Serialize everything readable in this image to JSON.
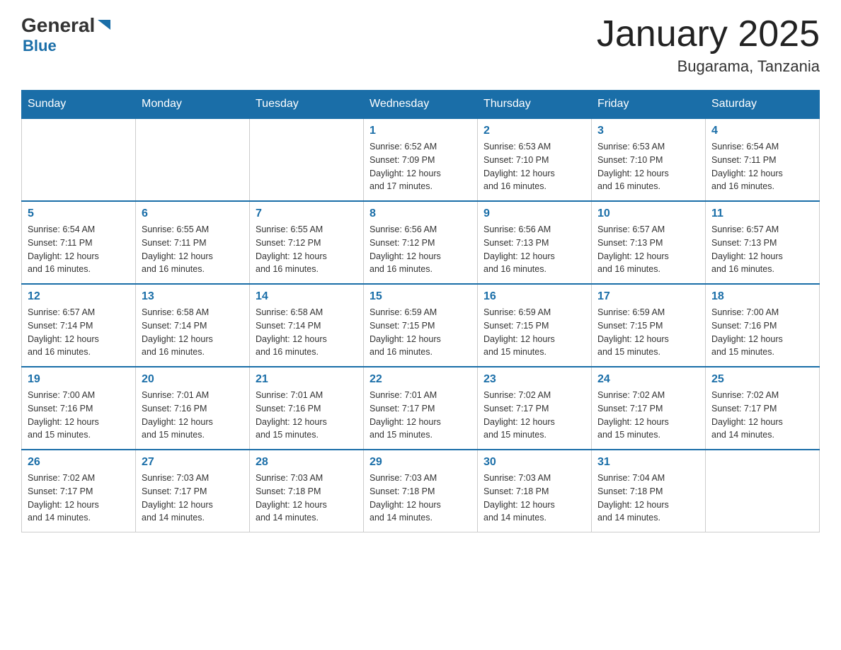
{
  "header": {
    "logo": {
      "general": "General",
      "triangle": "▶",
      "blue": "Blue"
    },
    "title": "January 2025",
    "subtitle": "Bugarama, Tanzania"
  },
  "days_of_week": [
    "Sunday",
    "Monday",
    "Tuesday",
    "Wednesday",
    "Thursday",
    "Friday",
    "Saturday"
  ],
  "weeks": [
    [
      {
        "day": "",
        "info": ""
      },
      {
        "day": "",
        "info": ""
      },
      {
        "day": "",
        "info": ""
      },
      {
        "day": "1",
        "info": "Sunrise: 6:52 AM\nSunset: 7:09 PM\nDaylight: 12 hours\nand 17 minutes."
      },
      {
        "day": "2",
        "info": "Sunrise: 6:53 AM\nSunset: 7:10 PM\nDaylight: 12 hours\nand 16 minutes."
      },
      {
        "day": "3",
        "info": "Sunrise: 6:53 AM\nSunset: 7:10 PM\nDaylight: 12 hours\nand 16 minutes."
      },
      {
        "day": "4",
        "info": "Sunrise: 6:54 AM\nSunset: 7:11 PM\nDaylight: 12 hours\nand 16 minutes."
      }
    ],
    [
      {
        "day": "5",
        "info": "Sunrise: 6:54 AM\nSunset: 7:11 PM\nDaylight: 12 hours\nand 16 minutes."
      },
      {
        "day": "6",
        "info": "Sunrise: 6:55 AM\nSunset: 7:11 PM\nDaylight: 12 hours\nand 16 minutes."
      },
      {
        "day": "7",
        "info": "Sunrise: 6:55 AM\nSunset: 7:12 PM\nDaylight: 12 hours\nand 16 minutes."
      },
      {
        "day": "8",
        "info": "Sunrise: 6:56 AM\nSunset: 7:12 PM\nDaylight: 12 hours\nand 16 minutes."
      },
      {
        "day": "9",
        "info": "Sunrise: 6:56 AM\nSunset: 7:13 PM\nDaylight: 12 hours\nand 16 minutes."
      },
      {
        "day": "10",
        "info": "Sunrise: 6:57 AM\nSunset: 7:13 PM\nDaylight: 12 hours\nand 16 minutes."
      },
      {
        "day": "11",
        "info": "Sunrise: 6:57 AM\nSunset: 7:13 PM\nDaylight: 12 hours\nand 16 minutes."
      }
    ],
    [
      {
        "day": "12",
        "info": "Sunrise: 6:57 AM\nSunset: 7:14 PM\nDaylight: 12 hours\nand 16 minutes."
      },
      {
        "day": "13",
        "info": "Sunrise: 6:58 AM\nSunset: 7:14 PM\nDaylight: 12 hours\nand 16 minutes."
      },
      {
        "day": "14",
        "info": "Sunrise: 6:58 AM\nSunset: 7:14 PM\nDaylight: 12 hours\nand 16 minutes."
      },
      {
        "day": "15",
        "info": "Sunrise: 6:59 AM\nSunset: 7:15 PM\nDaylight: 12 hours\nand 16 minutes."
      },
      {
        "day": "16",
        "info": "Sunrise: 6:59 AM\nSunset: 7:15 PM\nDaylight: 12 hours\nand 15 minutes."
      },
      {
        "day": "17",
        "info": "Sunrise: 6:59 AM\nSunset: 7:15 PM\nDaylight: 12 hours\nand 15 minutes."
      },
      {
        "day": "18",
        "info": "Sunrise: 7:00 AM\nSunset: 7:16 PM\nDaylight: 12 hours\nand 15 minutes."
      }
    ],
    [
      {
        "day": "19",
        "info": "Sunrise: 7:00 AM\nSunset: 7:16 PM\nDaylight: 12 hours\nand 15 minutes."
      },
      {
        "day": "20",
        "info": "Sunrise: 7:01 AM\nSunset: 7:16 PM\nDaylight: 12 hours\nand 15 minutes."
      },
      {
        "day": "21",
        "info": "Sunrise: 7:01 AM\nSunset: 7:16 PM\nDaylight: 12 hours\nand 15 minutes."
      },
      {
        "day": "22",
        "info": "Sunrise: 7:01 AM\nSunset: 7:17 PM\nDaylight: 12 hours\nand 15 minutes."
      },
      {
        "day": "23",
        "info": "Sunrise: 7:02 AM\nSunset: 7:17 PM\nDaylight: 12 hours\nand 15 minutes."
      },
      {
        "day": "24",
        "info": "Sunrise: 7:02 AM\nSunset: 7:17 PM\nDaylight: 12 hours\nand 15 minutes."
      },
      {
        "day": "25",
        "info": "Sunrise: 7:02 AM\nSunset: 7:17 PM\nDaylight: 12 hours\nand 14 minutes."
      }
    ],
    [
      {
        "day": "26",
        "info": "Sunrise: 7:02 AM\nSunset: 7:17 PM\nDaylight: 12 hours\nand 14 minutes."
      },
      {
        "day": "27",
        "info": "Sunrise: 7:03 AM\nSunset: 7:17 PM\nDaylight: 12 hours\nand 14 minutes."
      },
      {
        "day": "28",
        "info": "Sunrise: 7:03 AM\nSunset: 7:18 PM\nDaylight: 12 hours\nand 14 minutes."
      },
      {
        "day": "29",
        "info": "Sunrise: 7:03 AM\nSunset: 7:18 PM\nDaylight: 12 hours\nand 14 minutes."
      },
      {
        "day": "30",
        "info": "Sunrise: 7:03 AM\nSunset: 7:18 PM\nDaylight: 12 hours\nand 14 minutes."
      },
      {
        "day": "31",
        "info": "Sunrise: 7:04 AM\nSunset: 7:18 PM\nDaylight: 12 hours\nand 14 minutes."
      },
      {
        "day": "",
        "info": ""
      }
    ]
  ]
}
